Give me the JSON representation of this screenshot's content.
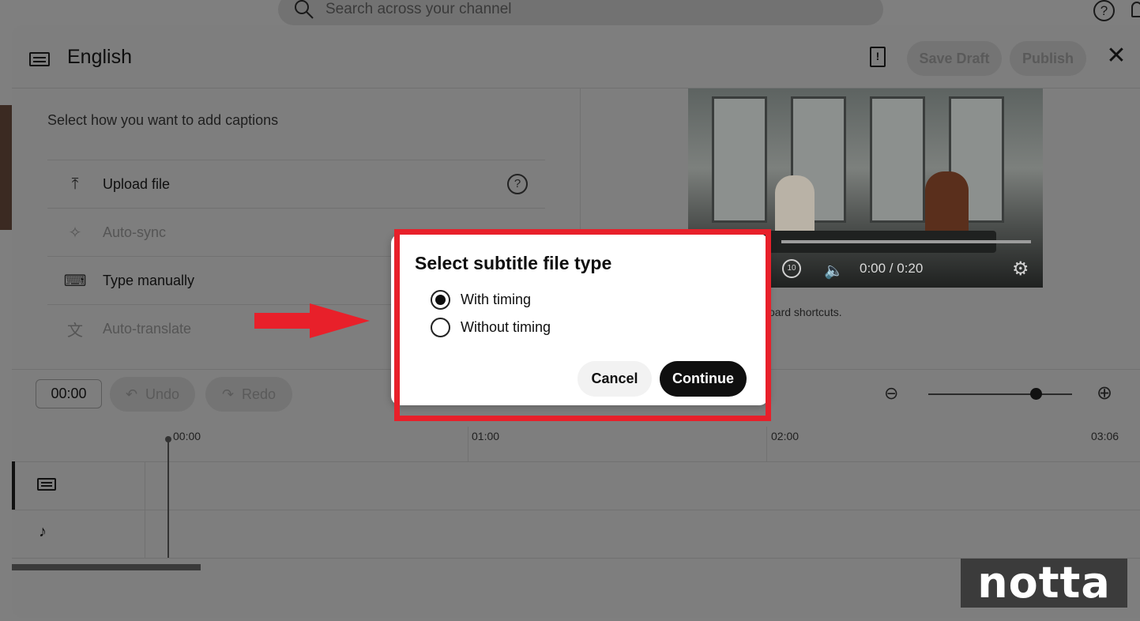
{
  "topbar": {
    "search_placeholder": "Search across your channel",
    "help_icon": "help-circle-icon",
    "bell_icon": "bell-icon"
  },
  "editor": {
    "title": "English",
    "save_draft_label": "Save Draft",
    "publish_label": "Publish",
    "close_icon": "close-icon",
    "captions_heading": "Select how you want to add captions",
    "options": [
      {
        "label": "Upload file",
        "icon": "upload-icon"
      },
      {
        "label": "Auto-sync",
        "icon": "sparkle-icon"
      },
      {
        "label": "Type manually",
        "icon": "keyboard-icon"
      },
      {
        "label": "Auto-translate",
        "icon": "translate-icon"
      }
    ],
    "video": {
      "time": "0:00 / 0:20",
      "replay_label": "10"
    },
    "shortcuts_text": "oard shortcuts."
  },
  "timeline": {
    "current_time": "00:00",
    "undo_label": "Undo",
    "redo_label": "Redo",
    "ticks": [
      "00:00",
      "01:00",
      "02:00",
      "03:06"
    ]
  },
  "modal": {
    "title": "Select subtitle file type",
    "options": [
      {
        "label": "With timing",
        "selected": true
      },
      {
        "label": "Without timing",
        "selected": false
      }
    ],
    "cancel_label": "Cancel",
    "continue_label": "Continue",
    "highlight_color": "#e8202a"
  },
  "annotation": {
    "arrow_color": "#e8202a"
  },
  "watermark": {
    "text": "notta"
  }
}
